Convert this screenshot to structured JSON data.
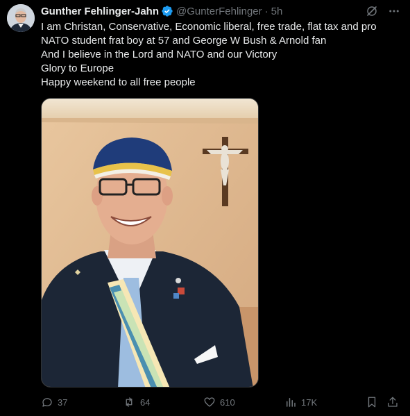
{
  "author": {
    "name": "Gunther Fehlinger-Jahn",
    "handle": "@GunterFehlinger",
    "time": "5h"
  },
  "tweet_lines": [
    "I am Christan, Conservative, Economic liberal, free trade, flat tax and pro",
    "NATO student frat boy at 57 and George W Bush & Arnold fan",
    "And I believe in the Lord and NATO and our Victory",
    "Glory to Europe",
    "Happy weekend to all free people"
  ],
  "metrics": {
    "replies": "37",
    "reposts": "64",
    "likes": "610",
    "views": "17K"
  },
  "icons": {
    "verified": "verified-badge-icon",
    "grok": "grok-icon",
    "more": "more-icon",
    "reply": "reply-icon",
    "repost": "repost-icon",
    "like": "heart-icon",
    "views": "analytics-icon",
    "bookmark": "bookmark-icon",
    "share": "share-icon"
  },
  "colors": {
    "background": "#000000",
    "text": "#e7e9ea",
    "muted": "#71767b",
    "verified": "#1d9bf0"
  }
}
